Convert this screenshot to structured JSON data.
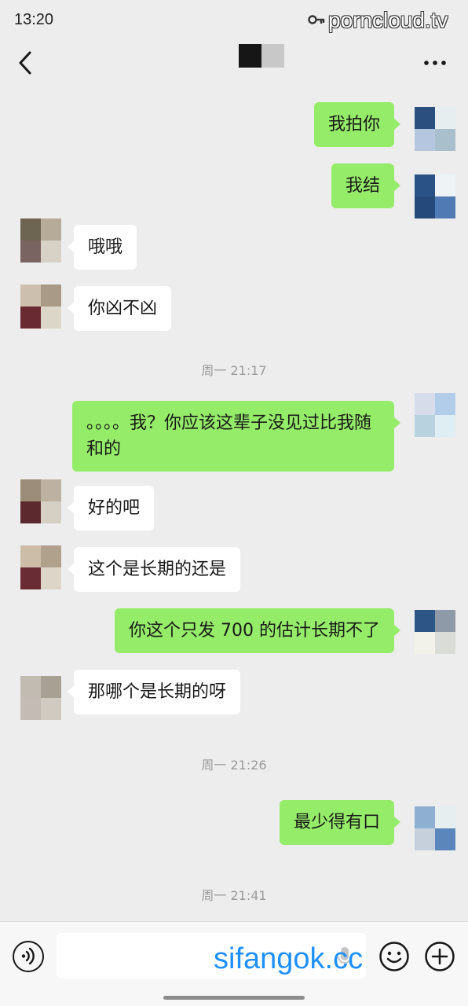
{
  "status_bar": {
    "time": "13:20",
    "watermark": "porncloud.tv"
  },
  "header": {
    "contact_name_redacted": ""
  },
  "messages": [
    {
      "sender": "me",
      "text": "我拍你"
    },
    {
      "sender": "me",
      "text": "我结"
    },
    {
      "sender": "other",
      "text": "哦哦"
    },
    {
      "sender": "other",
      "text": "你凶不凶"
    },
    {
      "timestamp": "周一 21:17"
    },
    {
      "sender": "me",
      "text": "。。。。我？你应该这辈子没见过比我随和的"
    },
    {
      "sender": "other",
      "text": "好的吧"
    },
    {
      "sender": "other",
      "text": "这个是长期的还是"
    },
    {
      "sender": "me",
      "text": "你这个只发 700 的估计长期不了"
    },
    {
      "sender": "other",
      "text": "那哪个是长期的呀"
    },
    {
      "timestamp": "周一 21:26"
    },
    {
      "sender": "me",
      "text": "最少得有口"
    },
    {
      "timestamp": "周一 21:41"
    }
  ],
  "input_bar": {
    "input_value": "",
    "watermark": "sifangok.cc"
  },
  "icons": {
    "back": "chevron-left-icon",
    "more": "more-dots-icon",
    "voice": "voice-icon",
    "mic": "mic-icon",
    "emoji": "emoji-icon",
    "plus": "plus-icon",
    "key": "key-icon"
  },
  "colors": {
    "background": "#ededed",
    "my_bubble": "#95ec69",
    "other_bubble": "#ffffff",
    "timestamp_text": "#9a9a9a",
    "watermark_bottom": "#1e90ff"
  }
}
